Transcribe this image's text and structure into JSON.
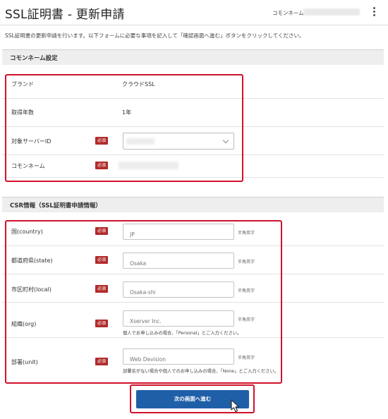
{
  "header": {
    "title": "SSL証明書 - 更新申請",
    "common_name_label": "コモンネーム"
  },
  "intro": "SSL証明書の更新申請を行います。以下フォームに必要な事項を記入して「確認画面へ進む」ボタンをクリックしてください。",
  "common_section": {
    "title": "コモンネーム設定",
    "rows": [
      {
        "label": "ブランド",
        "value": "クラウドSSL"
      },
      {
        "label": "取得年数",
        "value": "1年"
      },
      {
        "label": "対象サーバーID",
        "required": "必須"
      },
      {
        "label": "コモンネーム",
        "required": "必須"
      }
    ]
  },
  "csr_section": {
    "title": "CSR情報（SSL証明書申請情報）",
    "rows": [
      {
        "label": "国(country)",
        "required": "必須",
        "placeholder": "JP",
        "hint": "半角英字"
      },
      {
        "label": "都道府県(state)",
        "required": "必須",
        "placeholder": "Osaka",
        "hint": "半角英字"
      },
      {
        "label": "市区町村(local)",
        "required": "必須",
        "placeholder": "Osaka-shi",
        "hint": "半角英字"
      },
      {
        "label": "組織(org)",
        "required": "必須",
        "placeholder": "Xserver Inc.",
        "hint": "半角英字",
        "note": "個人でお申し込みの場合、「Personal」とご入力ください。"
      },
      {
        "label": "部署(unit)",
        "required": "必須",
        "placeholder": "Web Devision",
        "hint": "半角英字",
        "note": "部署名がない場合や個人でのお申し込みの場合、「None」とご入力ください。"
      }
    ]
  },
  "next_button": "次の画面へ進む",
  "colors": {
    "accent_blue": "#1f5fa8",
    "required_red": "#b22a2a",
    "highlight_red": "#d1112b"
  }
}
